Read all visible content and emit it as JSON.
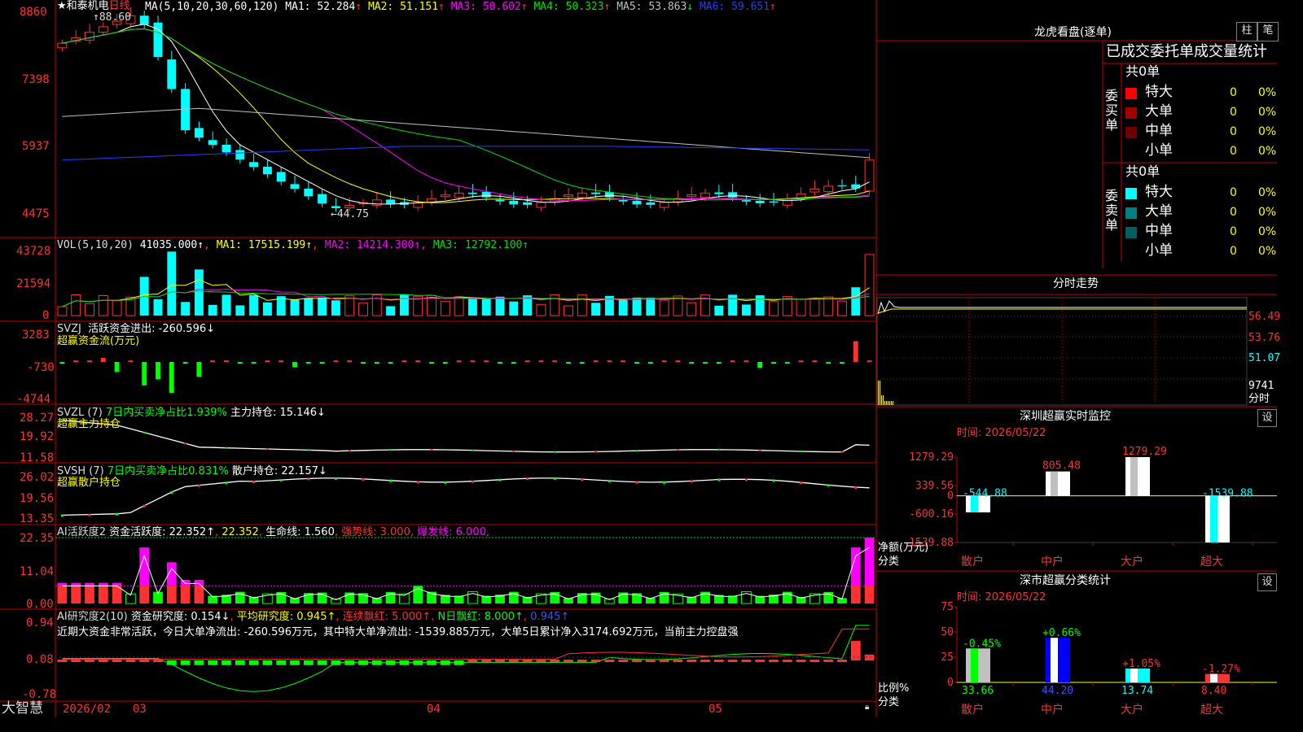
{
  "colors": {
    "up": "#ff3232",
    "down": "#00ffff",
    "grid": "#c00000",
    "bg": "#000000",
    "ma1": "#ffffff",
    "ma2": "#ffff00",
    "ma3": "#ff00ff",
    "ma4": "#00e000",
    "ma5": "#c0c0c0",
    "ma6": "#2040ff",
    "green": "#00ff00",
    "magenta": "#ff00ff",
    "yellow": "#ffff00"
  },
  "header": {
    "stock_name": "★和泰机电",
    "period": "日线",
    "ma_params": "MA(5,10,20,30,60,120)",
    "ma": [
      {
        "label": "MA1: 52.284",
        "arrow": "↑"
      },
      {
        "label": "MA2: 51.151",
        "arrow": "↑"
      },
      {
        "label": "MA3: 50.602",
        "arrow": "↑"
      },
      {
        "label": "MA4: 50.323",
        "arrow": "↑"
      },
      {
        "label": "MA5: 53.863",
        "arrow": "↓"
      },
      {
        "label": "MA6: 59.651",
        "arrow": "↑"
      }
    ]
  },
  "main_chart": {
    "y_ticks": [
      "8860",
      "7398",
      "5937",
      "4475"
    ],
    "high_label": "88.60",
    "low_label": "44.75"
  },
  "vol_panel": {
    "title": "VOL(5,10,20)",
    "value": "41035.000↑",
    "ma1": "MA1: 17515.199↑",
    "ma2": "MA2: 14214.300↑",
    "ma3": "MA3: 12792.100↑",
    "y_ticks": [
      "43728",
      "21594",
      "0"
    ]
  },
  "svzj_panel": {
    "title": "SVZJ",
    "label": "活跃资金进出: -260.596↓",
    "subtitle": "超赢资金流(万元)",
    "y_ticks": [
      "3283",
      "-730",
      "-4744"
    ]
  },
  "svzl_panel": {
    "title": "SVZL (7)",
    "net": "7日内买卖净占比1.939%",
    "label": "主力持仓: 15.146↓",
    "subtitle": "超赢主力持仓",
    "y_ticks": [
      "28.27",
      "19.92",
      "11.58"
    ]
  },
  "svsh_panel": {
    "title": "SVSH (7)",
    "net": "7日内买卖净占比0.831%",
    "label": "散户持仓: 22.157↓",
    "subtitle": "超赢散户持仓",
    "y_ticks": [
      "26.02",
      "19.56",
      "13.35"
    ]
  },
  "ai_active": {
    "title": "AI活跃度2",
    "label": "资金活跃度: 22.352↑",
    "v2": "22.352",
    "life": "生命线: 1.560",
    "strong": "强势线: 3.000",
    "burst": "爆发线: 6.000",
    "y_ticks": [
      "22.35",
      "11.04",
      "0.00"
    ]
  },
  "ai_research": {
    "title": "AI研究度2(10)",
    "label": "资金研究度: 0.154↓",
    "avg": "平均研究度: 0.945↑",
    "red": "连续飘红: 5.000↑",
    "nred": "N日飘红: 8.000↑",
    "blue": "0.945↑",
    "comment": "近期大资金非常活跃，今日大单净流出: -260.596万元，其中特大单净流出: -1539.885万元，大单5日累计净入3174.692万元，当前主力控盘强",
    "y_ticks": [
      "0.94",
      "0.08",
      "-0.78"
    ]
  },
  "bottom_axis": {
    "brand": "大智慧",
    "labels": [
      "2026/02",
      "03",
      "04",
      "05"
    ]
  },
  "dragon_tiger": {
    "title": "龙虎看盘(逐单)",
    "btn_bar": "柱",
    "btn_pen": "笔",
    "subtitle": "已成交委托单成交量统计",
    "buy": {
      "side": "委买单",
      "total": "共0单",
      "rows": [
        {
          "name": "特大",
          "count": "0",
          "pct": "0%",
          "color": "#ff0000"
        },
        {
          "name": "大单",
          "count": "0",
          "pct": "0%",
          "color": "#a00000"
        },
        {
          "name": "中单",
          "count": "0",
          "pct": "0%",
          "color": "#700000"
        },
        {
          "name": "小单",
          "count": "0",
          "pct": "0%",
          "color": "#000000"
        }
      ]
    },
    "sell": {
      "side": "委卖单",
      "total": "共0单",
      "rows": [
        {
          "name": "特大",
          "count": "0",
          "pct": "0%",
          "color": "#00ffff"
        },
        {
          "name": "大单",
          "count": "0",
          "pct": "0%",
          "color": "#008080"
        },
        {
          "name": "中单",
          "count": "0",
          "pct": "0%",
          "color": "#006060"
        },
        {
          "name": "小单",
          "count": "0",
          "pct": "0%",
          "color": "#000000"
        }
      ]
    }
  },
  "intraday": {
    "title": "分时走势",
    "y_ticks": [
      "56.49",
      "53.76",
      "51.07"
    ],
    "vol_tick": "9741",
    "vol_label": "分时"
  },
  "sz_monitor": {
    "title": "深圳超赢实时监控",
    "btn": "设",
    "date": "时间: 2026/05/22",
    "y_ticks": [
      "1279.29",
      "339.56",
      "0",
      "-600.16",
      "-1539.88"
    ],
    "axis_label": "净额(万元)",
    "x_axis_label": "分类",
    "chart_data": {
      "type": "bar",
      "categories": [
        "散户",
        "中户",
        "大户",
        "超大"
      ],
      "values": [
        -544.88,
        805.48,
        1279.29,
        -1539.88
      ],
      "ylim": [
        -1539.88,
        1279.29
      ]
    }
  },
  "sz_stats": {
    "title": "深市超赢分类统计",
    "btn": "设",
    "date": "时间: 2026/05/22",
    "y_ticks": [
      "75",
      "50",
      "25",
      "0"
    ],
    "axis_label": "比例%",
    "x_axis_label": "分类",
    "chart_data": {
      "type": "bar",
      "categories": [
        "散户",
        "中户",
        "大户",
        "超大"
      ],
      "values": [
        33.66,
        44.2,
        13.74,
        8.4
      ],
      "changes": [
        "-0.45%",
        "+0.66%",
        "+1.05%",
        "-1.27%"
      ],
      "ylim": [
        0,
        75
      ]
    }
  }
}
